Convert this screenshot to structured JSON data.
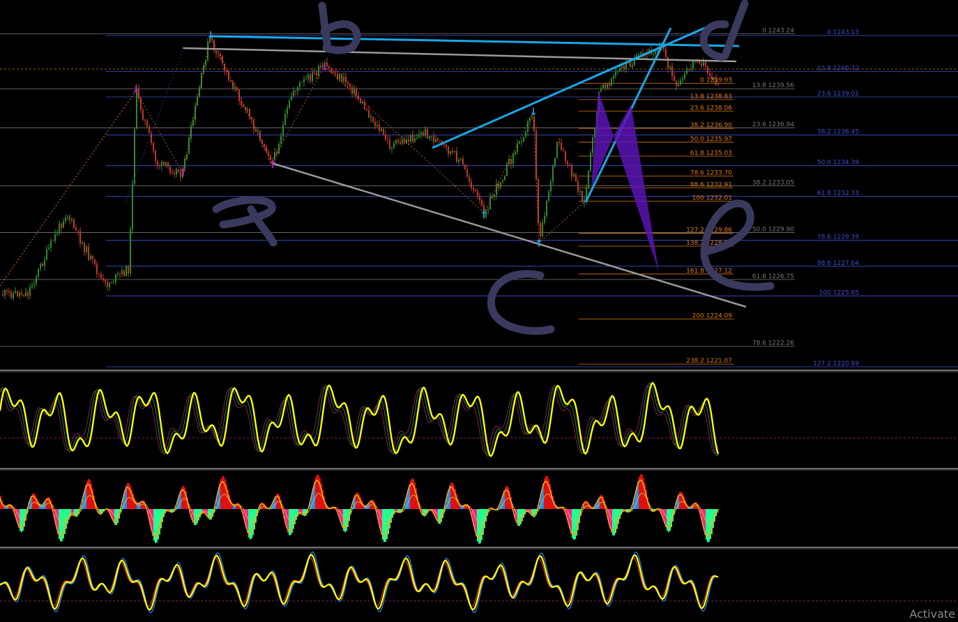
{
  "colors": {
    "background": "#000000",
    "bull_candle": "#2e8b2e",
    "bear_candle": "#c0392b",
    "fib_blue": "#3f4fd0",
    "fib_orange": "#e07a10",
    "fib_gray": "#777777",
    "trend_cyan": "#18a8e8",
    "trend_gray": "#9a9a9a",
    "pattern_purple": "#5a14b4",
    "oscillator_yellow": "#ffff00",
    "handwriting": "#3a3a5e"
  },
  "handwritten_labels": [
    "a",
    "b",
    "c",
    "d",
    "e"
  ],
  "chart_data": [
    {
      "type": "candlestick",
      "title": "",
      "fib_levels_blue": [
        {
          "label": "0 1243.13",
          "price": 1243.13
        },
        {
          "label": "13.8 1240.72",
          "price": 1240.72
        },
        {
          "label": "23.6 1239.01",
          "price": 1239.01
        },
        {
          "label": "38.2 1236.45",
          "price": 1236.45
        },
        {
          "label": "50.0 1234.39",
          "price": 1234.39
        },
        {
          "label": "61.8 1232.33",
          "price": 1232.33
        },
        {
          "label": "78.6 1229.39",
          "price": 1229.39
        },
        {
          "label": "88.6 1227.64",
          "price": 1227.64
        },
        {
          "label": "100 1225.65",
          "price": 1225.65
        },
        {
          "label": "127.2 1220.89",
          "price": 1220.89
        }
      ],
      "fib_levels_gray": [
        {
          "label": "0 1243.24",
          "price": 1243.24
        },
        {
          "label": "13.8 1239.56",
          "price": 1239.56
        },
        {
          "label": "23.6 1236.94",
          "price": 1236.94
        },
        {
          "label": "38.2 1233.05",
          "price": 1233.05
        },
        {
          "label": "50.0 1229.90",
          "price": 1229.9
        },
        {
          "label": "61.8 1226.75",
          "price": 1226.75
        },
        {
          "label": "78.6 1222.26",
          "price": 1222.26
        }
      ],
      "fib_levels_orange": [
        {
          "label": "0 1239.93",
          "price": 1239.93
        },
        {
          "label": "13.8 1238.83",
          "price": 1238.83
        },
        {
          "label": "23.6 1238.06",
          "price": 1238.06
        },
        {
          "label": "38.2 1236.90",
          "price": 1236.9
        },
        {
          "label": "50.0 1235.97",
          "price": 1235.97
        },
        {
          "label": "61.8 1235.03",
          "price": 1235.03
        },
        {
          "label": "78.6 1233.70",
          "price": 1233.7
        },
        {
          "label": "88.6 1232.91",
          "price": 1232.91
        },
        {
          "label": "100 1232.01",
          "price": 1232.01
        },
        {
          "label": "127.2 1229.86",
          "price": 1229.86
        },
        {
          "label": "138.2 1228.99",
          "price": 1228.99
        },
        {
          "label": "161.8 1227.12",
          "price": 1227.12
        },
        {
          "label": "200 1224.09",
          "price": 1224.09
        },
        {
          "label": "238.2 1221.07",
          "price": 1221.07
        }
      ]
    },
    {
      "type": "line",
      "name": "",
      "title": ""
    },
    {
      "type": "histogram",
      "name": "",
      "title": ""
    },
    {
      "type": "line",
      "name": "",
      "title": ""
    }
  ],
  "watermark": "Activate"
}
